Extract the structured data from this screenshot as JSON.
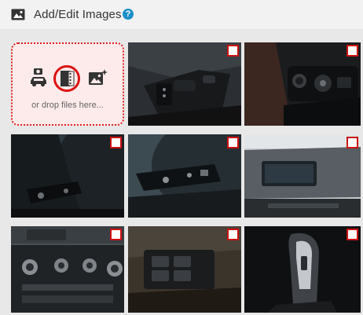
{
  "header": {
    "title": "Add/Edit Images",
    "help_label": "?"
  },
  "upload": {
    "drop_text": "or drop files here...",
    "icons": [
      "camera-car-icon",
      "film-strip-icon",
      "image-sparkle-icon"
    ],
    "highlight_color": "#dd1111"
  },
  "gallery": {
    "checkbox_color": "#cc1111",
    "items": [
      {
        "id": "photo-1",
        "subject": "door seat controls"
      },
      {
        "id": "photo-2",
        "subject": "dashboard light switch"
      },
      {
        "id": "photo-3",
        "subject": "steering wheel stalk"
      },
      {
        "id": "photo-4",
        "subject": "cruise control stalk"
      },
      {
        "id": "photo-5",
        "subject": "center display screen"
      },
      {
        "id": "photo-6",
        "subject": "climate control panel"
      },
      {
        "id": "photo-7",
        "subject": "center console buttons"
      },
      {
        "id": "photo-8",
        "subject": "gear shifter"
      }
    ]
  }
}
